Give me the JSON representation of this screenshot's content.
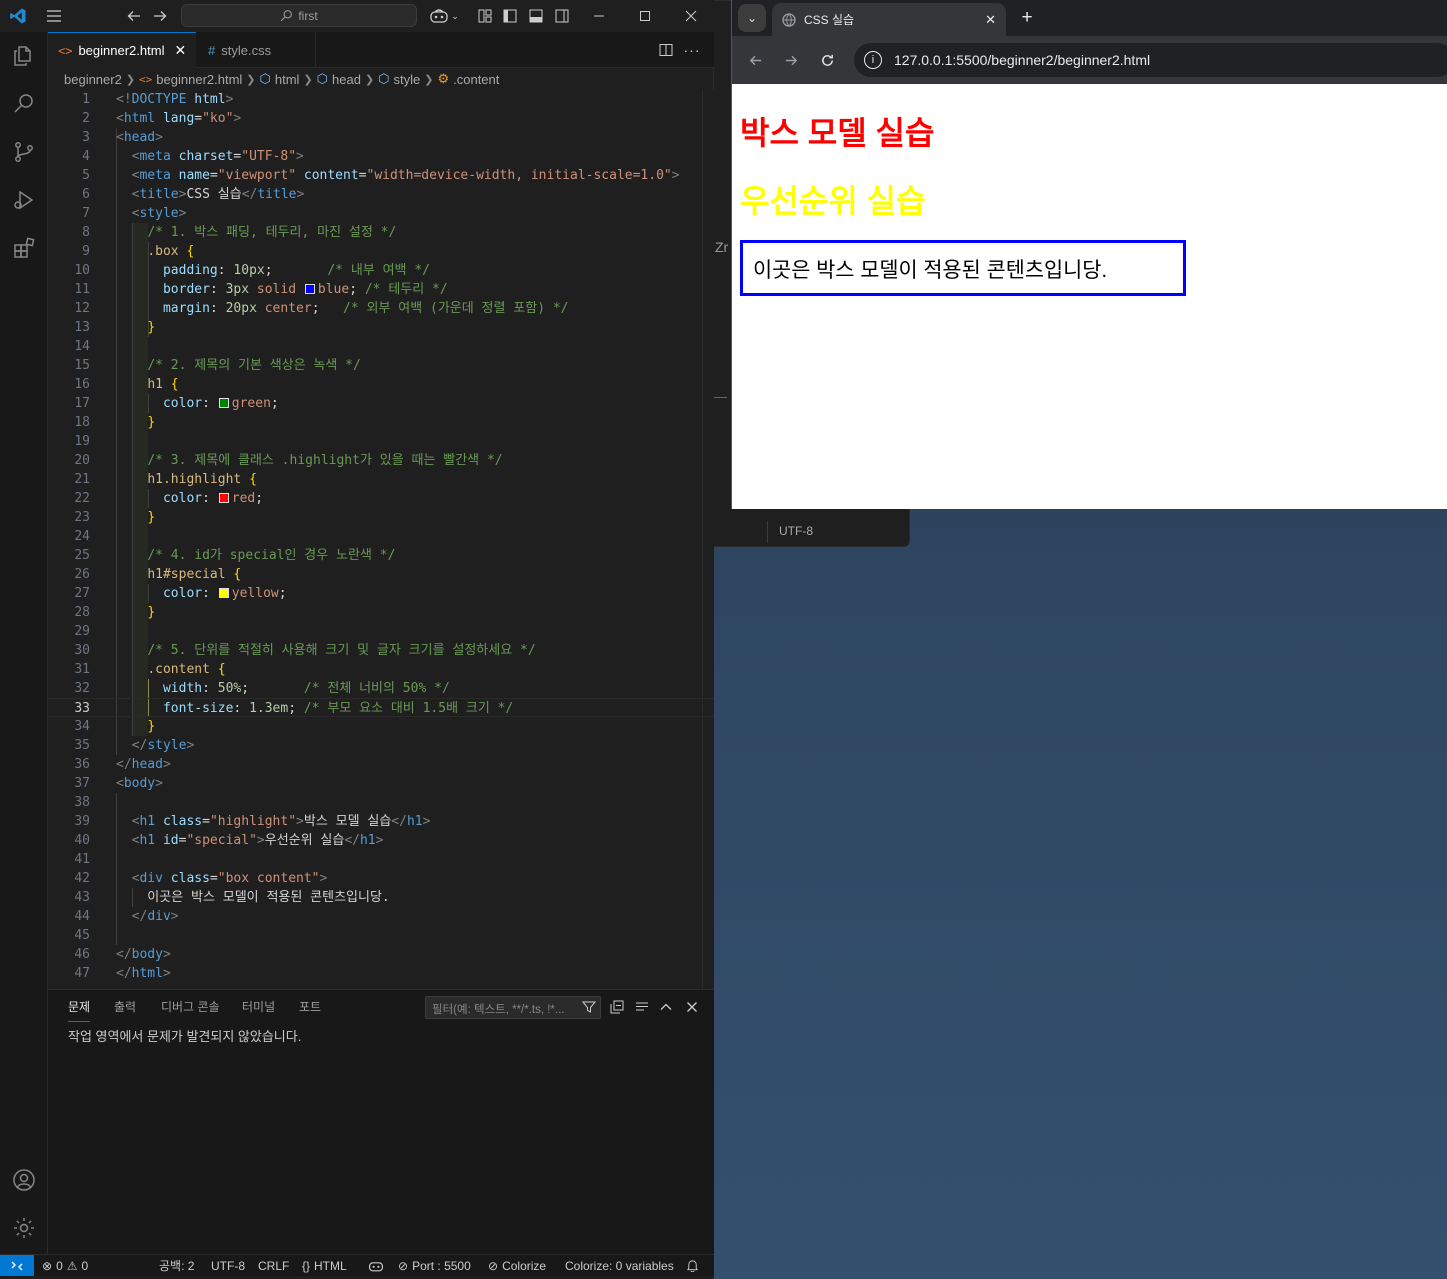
{
  "vscode": {
    "search_text": "first",
    "tabs": [
      {
        "label": "beginner2.html",
        "icon": "html-file-icon",
        "active": true
      },
      {
        "label": "style.css",
        "icon": "css-file-icon",
        "active": false
      }
    ],
    "breadcrumb": [
      "beginner2",
      "beginner2.html",
      "html",
      "head",
      "style",
      ".content"
    ],
    "code_lines": [
      [
        [
          "t-punc",
          "<!"
        ],
        [
          "t-tag",
          "DOCTYPE"
        ],
        [
          "t-txt",
          " "
        ],
        [
          "t-attr",
          "html"
        ],
        [
          "t-punc",
          ">"
        ]
      ],
      [
        [
          "t-punc",
          "<"
        ],
        [
          "t-tag",
          "html"
        ],
        [
          "t-txt",
          " "
        ],
        [
          "t-attr",
          "lang"
        ],
        [
          "t-txt",
          "="
        ],
        [
          "t-str",
          "\"ko\""
        ],
        [
          "t-punc",
          ">"
        ]
      ],
      [
        [
          "t-punc",
          "<"
        ],
        [
          "t-tag",
          "head"
        ],
        [
          "t-punc",
          ">"
        ]
      ],
      [
        [
          "t-txt",
          "  "
        ],
        [
          "t-punc",
          "<"
        ],
        [
          "t-tag",
          "meta"
        ],
        [
          "t-txt",
          " "
        ],
        [
          "t-attr",
          "charset"
        ],
        [
          "t-txt",
          "="
        ],
        [
          "t-str",
          "\"UTF-8\""
        ],
        [
          "t-punc",
          ">"
        ]
      ],
      [
        [
          "t-txt",
          "  "
        ],
        [
          "t-punc",
          "<"
        ],
        [
          "t-tag",
          "meta"
        ],
        [
          "t-txt",
          " "
        ],
        [
          "t-attr",
          "name"
        ],
        [
          "t-txt",
          "="
        ],
        [
          "t-str",
          "\"viewport\""
        ],
        [
          "t-txt",
          " "
        ],
        [
          "t-attr",
          "content"
        ],
        [
          "t-txt",
          "="
        ],
        [
          "t-str",
          "\"width=device-width, initial-scale=1.0\""
        ],
        [
          "t-punc",
          ">"
        ]
      ],
      [
        [
          "t-txt",
          "  "
        ],
        [
          "t-punc",
          "<"
        ],
        [
          "t-tag",
          "title"
        ],
        [
          "t-punc",
          ">"
        ],
        [
          "t-txt",
          "CSS 실습"
        ],
        [
          "t-punc",
          "</"
        ],
        [
          "t-tag",
          "title"
        ],
        [
          "t-punc",
          ">"
        ]
      ],
      [
        [
          "t-txt",
          "  "
        ],
        [
          "t-punc",
          "<"
        ],
        [
          "t-tag",
          "style"
        ],
        [
          "t-punc",
          ">"
        ]
      ],
      [
        [
          "t-txt",
          "    "
        ],
        [
          "t-cmt",
          "/* 1. 박스 패딩, 테두리, 마진 설정 */"
        ]
      ],
      [
        [
          "t-txt",
          "    "
        ],
        [
          "t-sel",
          ".box"
        ],
        [
          "t-txt",
          " "
        ],
        [
          "t-brace",
          "{"
        ]
      ],
      [
        [
          "t-txt",
          "      "
        ],
        [
          "t-prop",
          "padding"
        ],
        [
          "t-txt",
          ": "
        ],
        [
          "t-num",
          "10px"
        ],
        [
          "t-txt",
          ";       "
        ],
        [
          "t-cmt",
          "/* 내부 여백 */"
        ]
      ],
      [
        [
          "t-txt",
          "      "
        ],
        [
          "t-prop",
          "border"
        ],
        [
          "t-txt",
          ": "
        ],
        [
          "t-num",
          "3px"
        ],
        [
          "t-txt",
          " "
        ],
        [
          "t-str",
          "solid"
        ],
        [
          "t-txt",
          " "
        ],
        [
          "swatch",
          "#0000ff"
        ],
        [
          "t-str",
          "blue"
        ],
        [
          "t-txt",
          "; "
        ],
        [
          "t-cmt",
          "/* 테두리 */"
        ]
      ],
      [
        [
          "t-txt",
          "      "
        ],
        [
          "t-prop",
          "margin"
        ],
        [
          "t-txt",
          ": "
        ],
        [
          "t-num",
          "20px"
        ],
        [
          "t-txt",
          " "
        ],
        [
          "t-str",
          "center"
        ],
        [
          "t-txt",
          ";   "
        ],
        [
          "t-cmt",
          "/* 외부 여백 (가운데 정렬 포함) */"
        ]
      ],
      [
        [
          "t-txt",
          "    "
        ],
        [
          "t-brace",
          "}"
        ]
      ],
      [],
      [
        [
          "t-txt",
          "    "
        ],
        [
          "t-cmt",
          "/* 2. 제목의 기본 색상은 녹색 */"
        ]
      ],
      [
        [
          "t-txt",
          "    "
        ],
        [
          "t-sel",
          "h1"
        ],
        [
          "t-txt",
          " "
        ],
        [
          "t-brace",
          "{"
        ]
      ],
      [
        [
          "t-txt",
          "      "
        ],
        [
          "t-prop",
          "color"
        ],
        [
          "t-txt",
          ": "
        ],
        [
          "swatch",
          "#008000"
        ],
        [
          "t-str",
          "green"
        ],
        [
          "t-txt",
          ";"
        ]
      ],
      [
        [
          "t-txt",
          "    "
        ],
        [
          "t-brace",
          "}"
        ]
      ],
      [],
      [
        [
          "t-txt",
          "    "
        ],
        [
          "t-cmt",
          "/* 3. 제목에 클래스 .highlight가 있을 때는 빨간색 */"
        ]
      ],
      [
        [
          "t-txt",
          "    "
        ],
        [
          "t-sel",
          "h1.highlight"
        ],
        [
          "t-txt",
          " "
        ],
        [
          "t-brace",
          "{"
        ]
      ],
      [
        [
          "t-txt",
          "      "
        ],
        [
          "t-prop",
          "color"
        ],
        [
          "t-txt",
          ": "
        ],
        [
          "swatch",
          "#ff0000"
        ],
        [
          "t-str",
          "red"
        ],
        [
          "t-txt",
          ";"
        ]
      ],
      [
        [
          "t-txt",
          "    "
        ],
        [
          "t-brace",
          "}"
        ]
      ],
      [],
      [
        [
          "t-txt",
          "    "
        ],
        [
          "t-cmt",
          "/* 4. id가 special인 경우 노란색 */"
        ]
      ],
      [
        [
          "t-txt",
          "    "
        ],
        [
          "t-sel",
          "h1#special"
        ],
        [
          "t-txt",
          " "
        ],
        [
          "t-brace",
          "{"
        ]
      ],
      [
        [
          "t-txt",
          "      "
        ],
        [
          "t-prop",
          "color"
        ],
        [
          "t-txt",
          ": "
        ],
        [
          "swatch",
          "#ffff00"
        ],
        [
          "t-str",
          "yellow"
        ],
        [
          "t-txt",
          ";"
        ]
      ],
      [
        [
          "t-txt",
          "    "
        ],
        [
          "t-brace",
          "}"
        ]
      ],
      [],
      [
        [
          "t-txt",
          "    "
        ],
        [
          "t-cmt",
          "/* 5. 단위를 적절히 사용해 크기 및 글자 크기를 설정하세요 */"
        ]
      ],
      [
        [
          "t-txt",
          "    "
        ],
        [
          "t-sel",
          ".content"
        ],
        [
          "t-txt",
          " "
        ],
        [
          "t-brace",
          "{"
        ]
      ],
      [
        [
          "t-txt",
          "      "
        ],
        [
          "t-prop",
          "width"
        ],
        [
          "t-txt",
          ": "
        ],
        [
          "t-num",
          "50%"
        ],
        [
          "t-txt",
          ";       "
        ],
        [
          "t-cmt",
          "/* 전체 너비의 50% */"
        ]
      ],
      [
        [
          "t-txt",
          "      "
        ],
        [
          "t-prop",
          "font-size"
        ],
        [
          "t-txt",
          ": "
        ],
        [
          "t-num",
          "1.3em"
        ],
        [
          "t-txt",
          "; "
        ],
        [
          "t-cmt",
          "/* 부모 요소 대비 1.5배 크기 */"
        ]
      ],
      [
        [
          "t-txt",
          "    "
        ],
        [
          "t-brace",
          "}"
        ]
      ],
      [
        [
          "t-txt",
          "  "
        ],
        [
          "t-punc",
          "</"
        ],
        [
          "t-tag",
          "style"
        ],
        [
          "t-punc",
          ">"
        ]
      ],
      [
        [
          "t-punc",
          "</"
        ],
        [
          "t-tag",
          "head"
        ],
        [
          "t-punc",
          ">"
        ]
      ],
      [
        [
          "t-punc",
          "<"
        ],
        [
          "t-tag",
          "body"
        ],
        [
          "t-punc",
          ">"
        ]
      ],
      [],
      [
        [
          "t-txt",
          "  "
        ],
        [
          "t-punc",
          "<"
        ],
        [
          "t-tag",
          "h1"
        ],
        [
          "t-txt",
          " "
        ],
        [
          "t-attr",
          "class"
        ],
        [
          "t-txt",
          "="
        ],
        [
          "t-str",
          "\"highlight\""
        ],
        [
          "t-punc",
          ">"
        ],
        [
          "t-txt",
          "박스 모델 실습"
        ],
        [
          "t-punc",
          "</"
        ],
        [
          "t-tag",
          "h1"
        ],
        [
          "t-punc",
          ">"
        ]
      ],
      [
        [
          "t-txt",
          "  "
        ],
        [
          "t-punc",
          "<"
        ],
        [
          "t-tag",
          "h1"
        ],
        [
          "t-txt",
          " "
        ],
        [
          "t-attr",
          "id"
        ],
        [
          "t-txt",
          "="
        ],
        [
          "t-str",
          "\"special\""
        ],
        [
          "t-punc",
          ">"
        ],
        [
          "t-txt",
          "우선순위 실습"
        ],
        [
          "t-punc",
          "</"
        ],
        [
          "t-tag",
          "h1"
        ],
        [
          "t-punc",
          ">"
        ]
      ],
      [],
      [
        [
          "t-txt",
          "  "
        ],
        [
          "t-punc",
          "<"
        ],
        [
          "t-tag",
          "div"
        ],
        [
          "t-txt",
          " "
        ],
        [
          "t-attr",
          "class"
        ],
        [
          "t-txt",
          "="
        ],
        [
          "t-str",
          "\"box content\""
        ],
        [
          "t-punc",
          ">"
        ]
      ],
      [
        [
          "t-txt",
          "    이곳은 박스 모델이 적용된 콘텐츠입니당."
        ]
      ],
      [
        [
          "t-txt",
          "  "
        ],
        [
          "t-punc",
          "</"
        ],
        [
          "t-tag",
          "div"
        ],
        [
          "t-punc",
          ">"
        ]
      ],
      [],
      [
        [
          "t-punc",
          "</"
        ],
        [
          "t-tag",
          "body"
        ],
        [
          "t-punc",
          ">"
        ]
      ],
      [
        [
          "t-punc",
          "</"
        ],
        [
          "t-tag",
          "html"
        ],
        [
          "t-punc",
          ">"
        ]
      ]
    ],
    "current_line": 33,
    "panel": {
      "tabs": [
        "문제",
        "출력",
        "디버그 콘솔",
        "터미널",
        "포트"
      ],
      "active_tab": "문제",
      "filter_placeholder": "필터(예: 텍스트, **/*.ts, !*...",
      "message": "작업 영역에서 문제가 발견되지 않았습니다."
    },
    "status": {
      "errors": "0",
      "warnings": "0",
      "indent": "공백: 2",
      "encoding": "UTF-8",
      "eol": "CRLF",
      "language": "HTML",
      "port": "Port : 5500",
      "colorize": "Colorize",
      "colorize_vars": "Colorize: 0 variables"
    }
  },
  "background_window": {
    "partial_text": "Zr",
    "encoding": "UTF-8"
  },
  "browser": {
    "tab_title": "CSS 실습",
    "url": "127.0.0.1:5500/beginner2/beginner2.html",
    "page": {
      "h1_highlight": "박스 모델 실습",
      "h1_special": "우선순위 실습",
      "box_text": "이곳은 박스 모델이 적용된 콘텐츠입니당.",
      "colors": {
        "highlight": "#ff0000",
        "special": "#ffff00",
        "box_border": "#0000ff"
      }
    }
  }
}
